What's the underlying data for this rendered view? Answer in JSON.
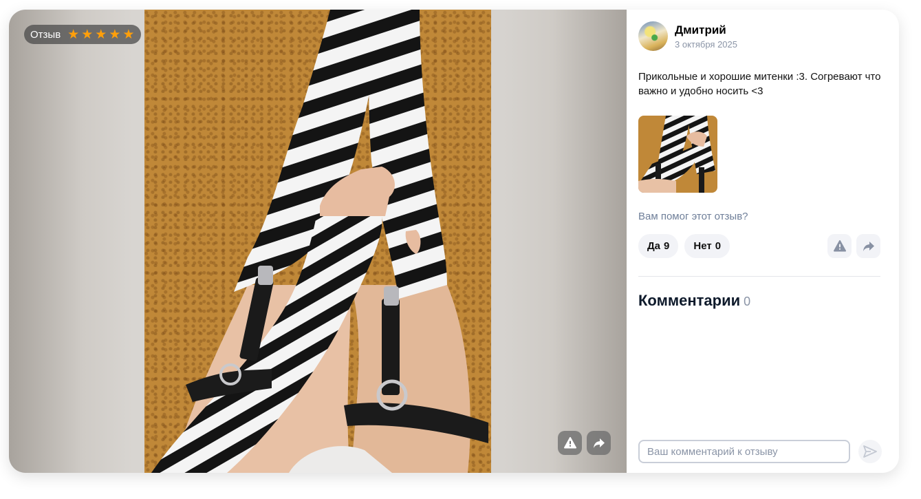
{
  "badge": {
    "label": "Отзыв",
    "rating": 5,
    "stars": [
      "★",
      "★",
      "★",
      "★",
      "★"
    ]
  },
  "review": {
    "author_name": "Дмитрий",
    "date": "3 октября 2025",
    "text": "Прикольные и хорошие митенки :3. Согревают что важно и удобно носить <3"
  },
  "helpful": {
    "question": "Вам помог этот отзыв?",
    "yes_label": "Да",
    "yes_count": "9",
    "no_label": "Нет",
    "no_count": "0"
  },
  "comments": {
    "title": "Комментарии",
    "count": "0",
    "placeholder": "Ваш комментарий к отзыву"
  },
  "icons": {
    "report": "warning-icon",
    "share": "share-arrow-icon",
    "send": "send-icon"
  },
  "colors": {
    "star": "#ff9f0a",
    "muted_text": "#8a94a6",
    "button_bg": "#f2f3f7"
  }
}
